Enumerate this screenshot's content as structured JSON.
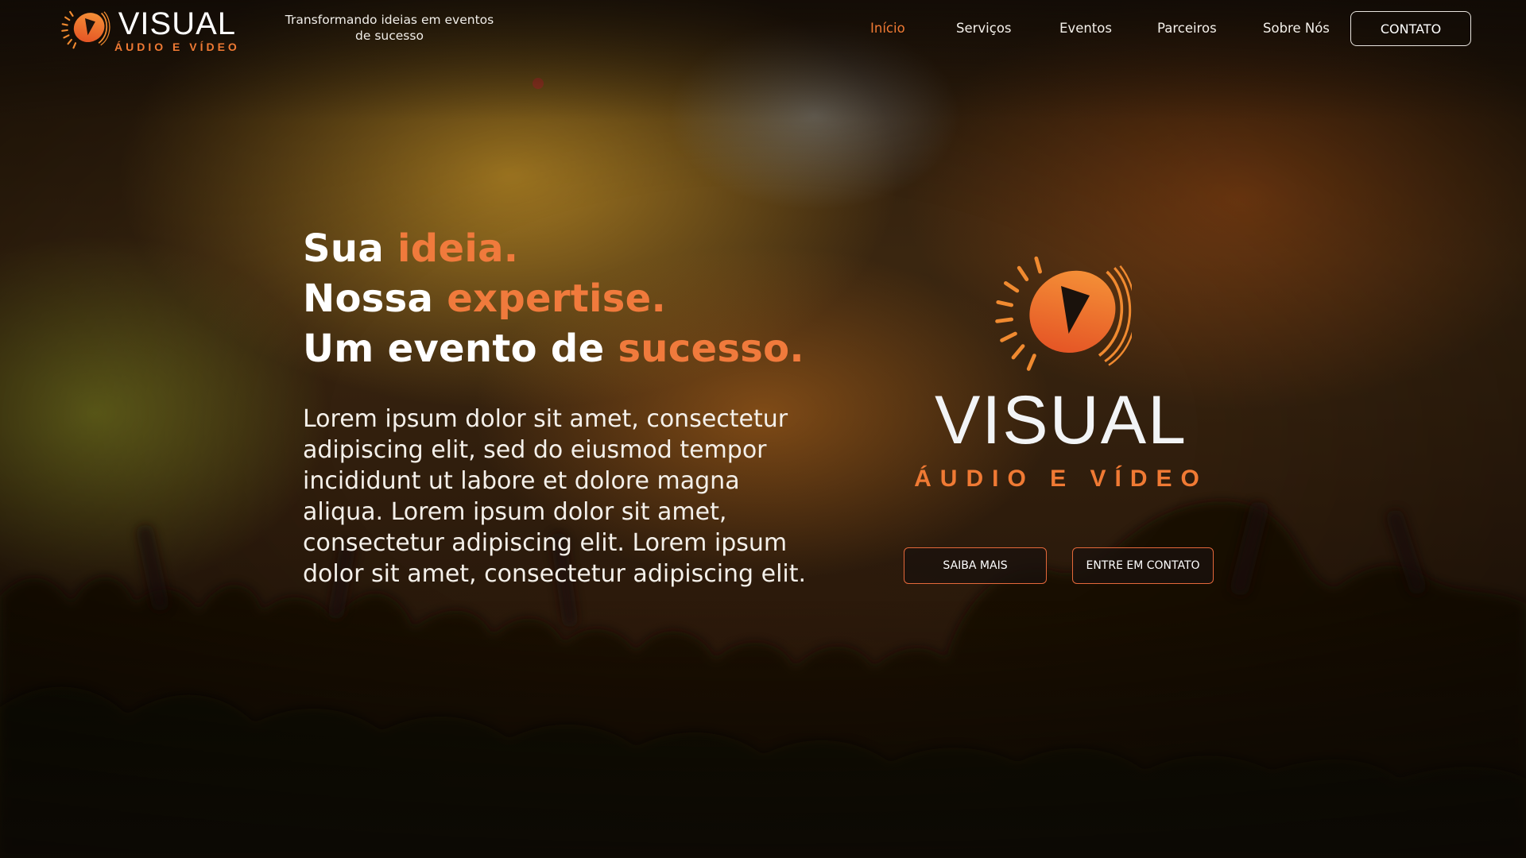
{
  "brand": {
    "name": "VISUAL",
    "subtitle": "ÁUDIO E VÍDEO",
    "accent_color": "#f07a34"
  },
  "header": {
    "tagline": "Transformando ideias em eventos de sucesso",
    "nav": [
      {
        "label": "Início",
        "active": true
      },
      {
        "label": "Serviços",
        "active": false
      },
      {
        "label": "Eventos",
        "active": false
      },
      {
        "label": "Parceiros",
        "active": false
      },
      {
        "label": "Sobre Nós",
        "active": false
      }
    ],
    "contact_label": "CONTATO"
  },
  "hero": {
    "line1": {
      "plain": "Sua ",
      "highlight": "ideia."
    },
    "line2": {
      "plain": "Nossa ",
      "highlight": "expertise."
    },
    "line3": {
      "plain": "Um evento de ",
      "highlight": "sucesso."
    },
    "body": "Lorem ipsum dolor sit amet, consectetur adipiscing elit, sed do eiusmod tempor incididunt ut labore et dolore magna aliqua. Lorem ipsum dolor sit amet, consectetur adipiscing elit. Lorem ipsum dolor sit amet, consectetur adipiscing elit.",
    "buttons": {
      "learn_more": "SAIBA MAIS",
      "get_in_touch": "ENTRE EM CONTATO"
    }
  },
  "icons": [
    "play-emblem-icon"
  ]
}
